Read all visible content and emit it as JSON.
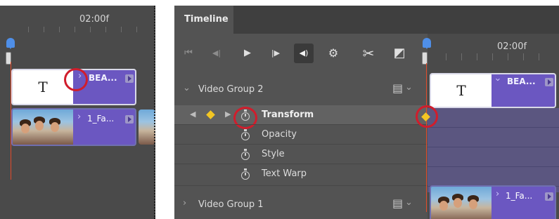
{
  "left_panel": {
    "ruler_time": "02:00f",
    "title_clip": {
      "label": "BEA...",
      "t_glyph": "T"
    },
    "video_clip": {
      "label": "1_Fa..."
    }
  },
  "right_panel": {
    "tab_title": "Timeline",
    "toolbar": {
      "go_to_first": "⏮",
      "prev_frame": "◀|",
      "play": "▶",
      "next_frame": "|▶",
      "mute": "◀)",
      "settings": "⚙",
      "split": "✂",
      "transition": "◩"
    },
    "ruler_time": "02:00f",
    "tracks": [
      {
        "label": "Video Group 2",
        "expanded": true
      },
      {
        "label": "Video Group 1",
        "expanded": false
      }
    ],
    "properties": [
      "Transform",
      "Opacity",
      "Style",
      "Text Warp"
    ],
    "title_clip": {
      "label": "BEA...",
      "t_glyph": "T"
    },
    "video_clip": {
      "label": "1_Fa..."
    },
    "colors": {
      "clip_purple": "#6b57c1",
      "keyframe_yellow": "#f3c623",
      "playhead_blue": "#4f8fe8",
      "highlight_red": "#d01d2c"
    }
  },
  "icons": {
    "film": "▤",
    "caret_down": "⌄",
    "caret_right": "›",
    "stopwatch": "stopwatch-icon"
  }
}
